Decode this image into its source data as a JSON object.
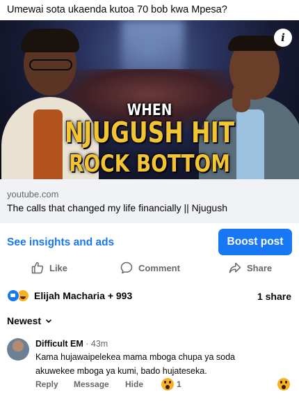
{
  "post": {
    "caption": "Umewai sota ukaenda kutoa 70 bob kwa Mpesa?"
  },
  "thumbnail": {
    "line1": "WHEN",
    "line2": "NJUGUSH HIT",
    "line3": "ROCK BOTTOM",
    "info_icon": "info-icon",
    "accent_color": "#f3c433"
  },
  "link": {
    "domain": "youtube.com",
    "title": "The calls that changed my life financially || Njugush"
  },
  "insights": {
    "label": "See insights and ads",
    "boost_label": "Boost post",
    "accent": "#1877f2"
  },
  "actions": {
    "like": "Like",
    "comment": "Comment",
    "share": "Share"
  },
  "reactions": {
    "icons": [
      "like-reaction-icon",
      "haha-reaction-icon"
    ],
    "summary": "Elijah Macharia + 993",
    "shares": "1 share"
  },
  "comments": {
    "sort_label": "Newest",
    "items": [
      {
        "author": "Difficult EM",
        "separator": "·",
        "time": "43m",
        "text": "Kama hujawaipelekea mama mboga chupa ya soda akuwekee mboga ya kumi, bado hujateseka.",
        "reply": "Reply",
        "message": "Message",
        "hide": "Hide",
        "reaction_count": "1"
      }
    ]
  }
}
